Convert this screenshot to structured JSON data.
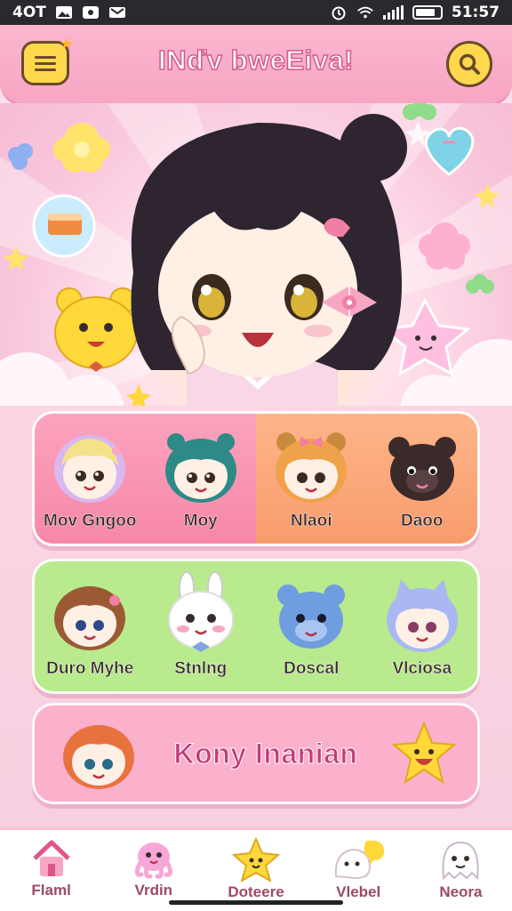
{
  "status_bar": {
    "carrier": "4OT",
    "time": "51:57",
    "icons": [
      "image-icon",
      "message-icon",
      "mail-icon",
      "alarm-icon",
      "wifi-icon",
      "signal-icon",
      "battery-icon"
    ]
  },
  "header": {
    "title": "INďv bweEiva!",
    "menu_icon": "menu-icon",
    "search_icon": "search-icon"
  },
  "categories": {
    "row1": [
      {
        "label": "Mov Gngoo",
        "hair": "#d9b8f0",
        "style": "girl"
      },
      {
        "label": "Moy",
        "hair": "#2e8a86",
        "style": "boy"
      },
      {
        "label": "Nlaoi",
        "hair": "#f0a24a",
        "style": "bear-girl"
      },
      {
        "label": "Daoo",
        "hair": "#3b2a2a",
        "style": "bear"
      }
    ],
    "row2": [
      {
        "label": "Duro Myhe",
        "hair": "#9b5a34",
        "style": "girl"
      },
      {
        "label": "Stnlng",
        "hair": "#ffffff",
        "style": "bunny"
      },
      {
        "label": "Doscal",
        "hair": "#6f9ee0",
        "style": "bear"
      },
      {
        "label": "Vlciosa",
        "hair": "#a9b8f2",
        "style": "cat-girl"
      }
    ]
  },
  "banner": {
    "label": "Kony Inanian",
    "avatar_hair": "#e8723e"
  },
  "bottom_nav": [
    {
      "label": "Flaml",
      "icon": "home-icon"
    },
    {
      "label": "Vrdin",
      "icon": "octopus-icon"
    },
    {
      "label": "Doteere",
      "icon": "star-icon"
    },
    {
      "label": "Vlebel",
      "icon": "ghost-chat-icon"
    },
    {
      "label": "Neora",
      "icon": "ghost-icon"
    }
  ],
  "colors": {
    "accent_pink": "#f7a6c3",
    "accent_yellow": "#ffd84d",
    "title_stroke": "#d6588a",
    "panel_green": "#b9ea8e",
    "panel_orange": "#f99c6c"
  }
}
